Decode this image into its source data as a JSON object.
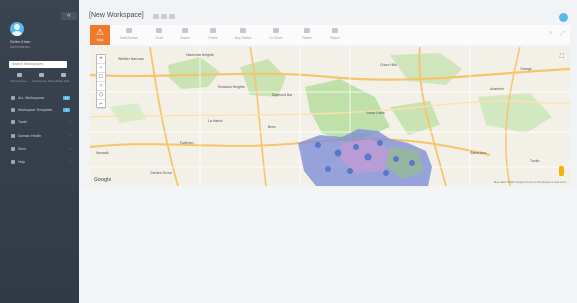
{
  "sidebar": {
    "collapse_label": "«",
    "user_name": "Selim Khan",
    "user_role": "Administrator",
    "search_placeholder": "Search Workspaces",
    "quick_icons": [
      {
        "label": "Workspaces",
        "icon": "grid-icon"
      },
      {
        "label": "Workspace Shares",
        "icon": "share-icon"
      },
      {
        "label": "Data Hub",
        "icon": "database-icon"
      }
    ],
    "items": [
      {
        "label": "ALL Workspaces",
        "icon": "folder-icon",
        "badge": "14"
      },
      {
        "label": "Workspace Templates",
        "icon": "template-icon",
        "badge": "3"
      },
      {
        "label": "Trade",
        "icon": "trade-icon"
      },
      {
        "label": "Domain Health",
        "icon": "health-icon"
      },
      {
        "label": "Store",
        "icon": "store-icon"
      },
      {
        "label": "Help",
        "icon": "help-icon"
      }
    ]
  },
  "header": {
    "title": "[New Workspace]"
  },
  "toolbar": {
    "active": {
      "label": "Map",
      "icon": "warning-icon"
    },
    "items": [
      {
        "label": "Data Browse",
        "icon": "database-icon"
      },
      {
        "label": "Chart",
        "icon": "chart-icon"
      },
      {
        "label": "Search",
        "icon": "search-icon"
      },
      {
        "label": "Profile",
        "icon": "profile-icon"
      },
      {
        "label": "Map Sketch",
        "icon": "sketch-icon"
      },
      {
        "label": "Go Share",
        "icon": "share-icon"
      },
      {
        "label": "Pattern",
        "icon": "pattern-icon"
      },
      {
        "label": "Report",
        "icon": "report-icon"
      }
    ]
  },
  "map": {
    "zoom_in": "+",
    "zoom_out": "−",
    "brand": "Google",
    "attribution": "Map data ©2021 Google   Terms of Use   Report a map error",
    "places": [
      "Whittier Narrows",
      "Hacienda Heights",
      "Chino Hills",
      "Rowland Heights",
      "Diamond Bar",
      "La Habra",
      "Brea",
      "Fullerton",
      "Norwalk",
      "Yorba Linda",
      "Anaheim",
      "Garden Grove",
      "Santa Ana",
      "Orange",
      "Tustin"
    ]
  }
}
